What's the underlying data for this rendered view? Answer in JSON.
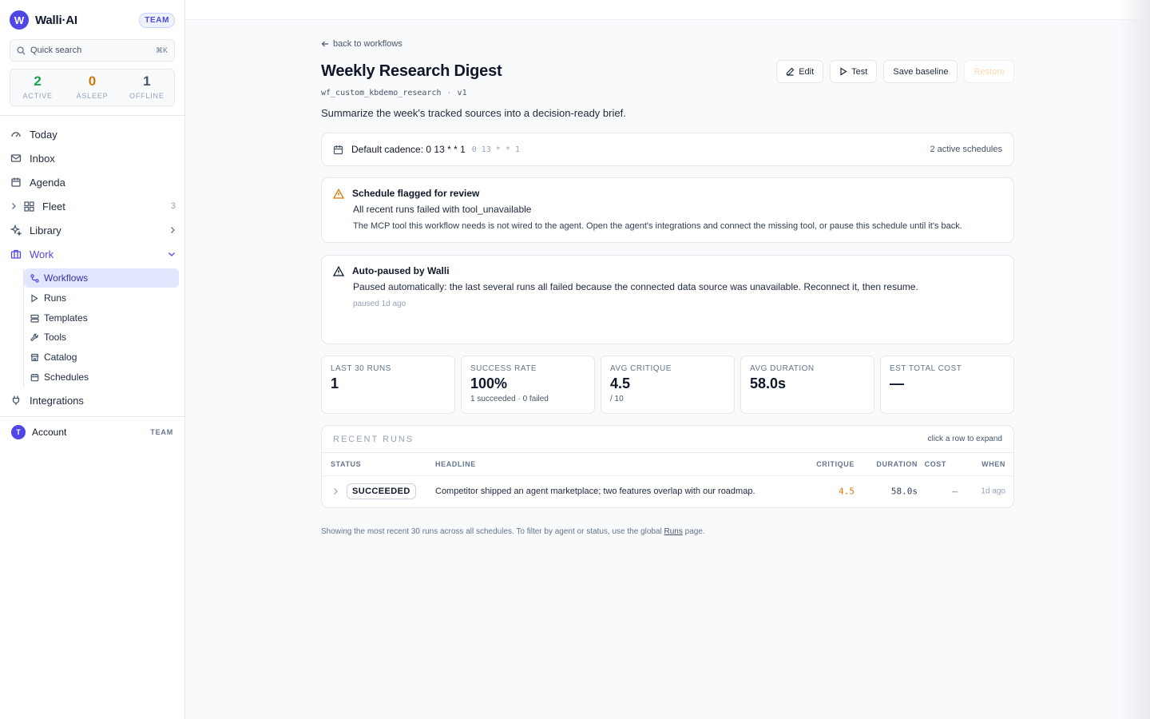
{
  "brand": {
    "logo_letter": "W",
    "name": "Walli·AI",
    "plan_badge": "TEAM"
  },
  "search": {
    "placeholder": "Quick search",
    "shortcut": "⌘K"
  },
  "fleet_stats": [
    {
      "value": "2",
      "label": "ACTIVE",
      "color": "#16a34a"
    },
    {
      "value": "0",
      "label": "ASLEEP",
      "color": "#d97706"
    },
    {
      "value": "1",
      "label": "OFFLINE",
      "color": "#475569"
    }
  ],
  "nav": {
    "today": "Today",
    "inbox": "Inbox",
    "agenda": "Agenda",
    "fleet": "Fleet",
    "fleet_count": "3",
    "library": "Library",
    "work": "Work",
    "integrations": "Integrations"
  },
  "work_sub": {
    "workflows": "Workflows",
    "runs": "Runs",
    "templates": "Templates",
    "tools": "Tools",
    "catalog": "Catalog",
    "schedules": "Schedules"
  },
  "account": {
    "initial": "T",
    "label": "Account",
    "tag": "TEAM"
  },
  "page": {
    "back_label": "back to workflows",
    "title": "Weekly Research Digest",
    "workflow_id": "wf_custom_kbdemo_research",
    "version": "v1",
    "description": "Summarize the week's tracked sources into a decision-ready brief."
  },
  "actions": {
    "edit": "Edit",
    "test": "Test",
    "save_baseline": "Save baseline",
    "restore": "Restore"
  },
  "cadence": {
    "text": "Default cadence: 0 13 * * 1",
    "cron": "0 13 * * 1",
    "schedules": "2 active schedules"
  },
  "review_alert": {
    "title": "Schedule flagged for review",
    "line1": "All recent runs failed with tool_unavailable",
    "line2": "The MCP tool this workflow needs is not wired to the agent. Open the agent's integrations and connect the missing tool, or pause this schedule until it's back."
  },
  "paused_alert": {
    "title": "Auto-paused by Walli",
    "line1": "Paused automatically: the last several runs all failed because the connected data source was unavailable. Reconnect it, then resume.",
    "meta": "paused 1d ago"
  },
  "stats": [
    {
      "label": "LAST 30 RUNS",
      "value": "1",
      "sub": ""
    },
    {
      "label": "SUCCESS RATE",
      "value": "100%",
      "sub": "1 succeeded · 0 failed"
    },
    {
      "label": "AVG CRITIQUE",
      "value": "4.5",
      "sub": "/ 10"
    },
    {
      "label": "AVG DURATION",
      "value": "58.0s",
      "sub": ""
    },
    {
      "label": "EST TOTAL COST",
      "value": "—",
      "sub": ""
    }
  ],
  "recent_runs": {
    "title": "RECENT RUNS",
    "hint": "click a row to expand",
    "columns": {
      "status": "STATUS",
      "headline": "HEADLINE",
      "critique": "CRITIQUE",
      "duration": "DURATION",
      "cost": "COST",
      "when": "WHEN"
    },
    "rows": [
      {
        "status": "SUCCEEDED",
        "headline": "Competitor shipped an agent marketplace; two features overlap with our roadmap.",
        "critique": "4.5",
        "duration": "58.0s",
        "cost": "–",
        "when": "1d ago"
      }
    ]
  },
  "footer": {
    "text_before": "Showing the most recent 30 runs across all schedules. To filter by agent or status, use the global",
    "link": "Runs",
    "text_after": "page."
  }
}
